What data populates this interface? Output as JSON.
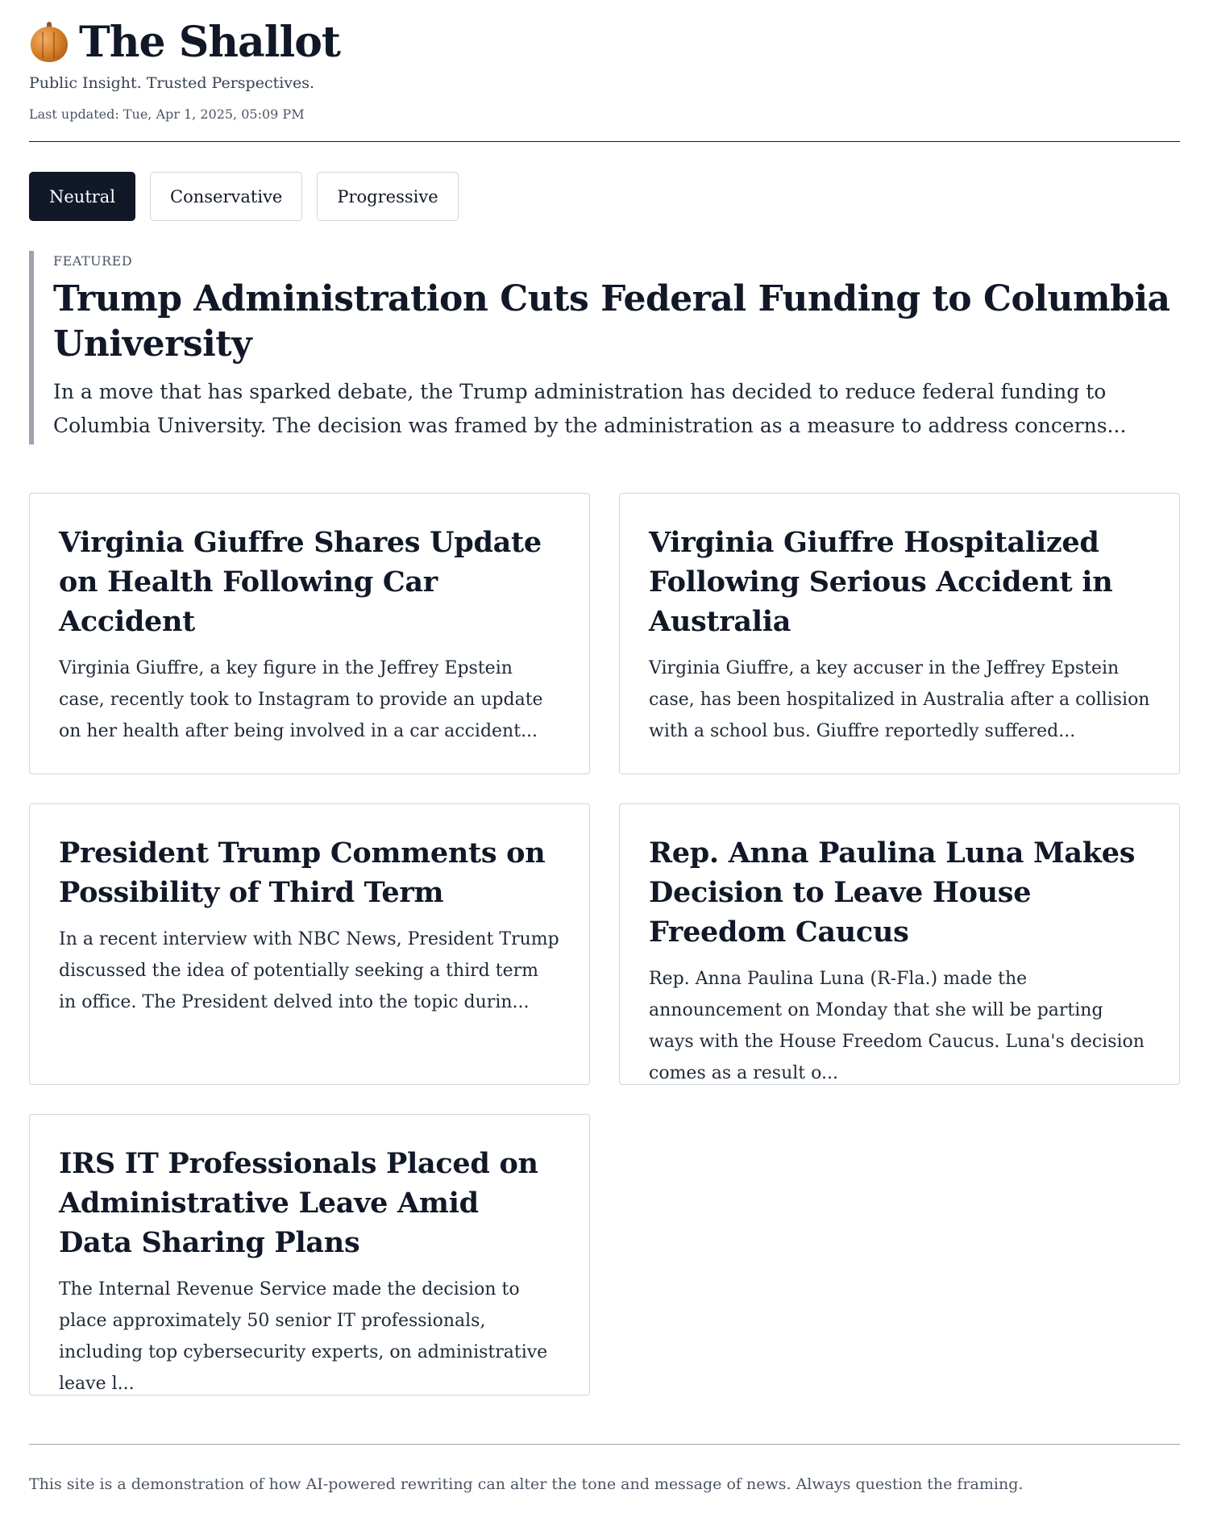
{
  "header": {
    "site_title": "The Shallot",
    "logo_icon": "onion-icon",
    "tagline": "Public Insight. Trusted Perspectives.",
    "last_updated": "Last updated: Tue, Apr 1, 2025, 05:09 PM"
  },
  "tabs": [
    {
      "label": "Neutral",
      "active": true
    },
    {
      "label": "Conservative",
      "active": false
    },
    {
      "label": "Progressive",
      "active": false
    }
  ],
  "featured": {
    "label": "FEATURED",
    "title": "Trump Administration Cuts Federal Funding to Columbia University",
    "excerpt": "In a move that has sparked debate, the Trump administration has decided to reduce federal funding to Columbia University. The decision was framed by the administration as a measure to address concerns..."
  },
  "articles": [
    {
      "title": "Virginia Giuffre Shares Update on Health Following Car Accident",
      "excerpt": "Virginia Giuffre, a key figure in the Jeffrey Epstein case, recently took to Instagram to provide an update on her health after being involved in a car accident..."
    },
    {
      "title": "Virginia Giuffre Hospitalized Following Serious Accident in Australia",
      "excerpt": "Virginia Giuffre, a key accuser in the Jeffrey Epstein case, has been hospitalized in Australia after a collision with a school bus. Giuffre reportedly suffered..."
    },
    {
      "title": "President Trump Comments on Possibility of Third Term",
      "excerpt": "In a recent interview with NBC News, President Trump discussed the idea of potentially seeking a third term in office. The President delved into the topic durin..."
    },
    {
      "title": "Rep. Anna Paulina Luna Makes Decision to Leave House Freedom Caucus",
      "excerpt": "Rep. Anna Paulina Luna (R-Fla.) made the announcement on Monday that she will be parting ways with the House Freedom Caucus. Luna's decision comes as a result o..."
    },
    {
      "title": "IRS IT Professionals Placed on Administrative Leave Amid Data Sharing Plans",
      "excerpt": "The Internal Revenue Service made the decision to place approximately 50 senior IT professionals, including top cybersecurity experts, on administrative leave l..."
    }
  ],
  "footer": {
    "note": "This site is a demonstration of how AI-powered rewriting can alter the tone and message of news. Always question the framing."
  },
  "colors": {
    "text": "#111827",
    "active_tab_bg": "#111827",
    "border": "#d1d5db",
    "featured_bar": "#9ca3af"
  }
}
